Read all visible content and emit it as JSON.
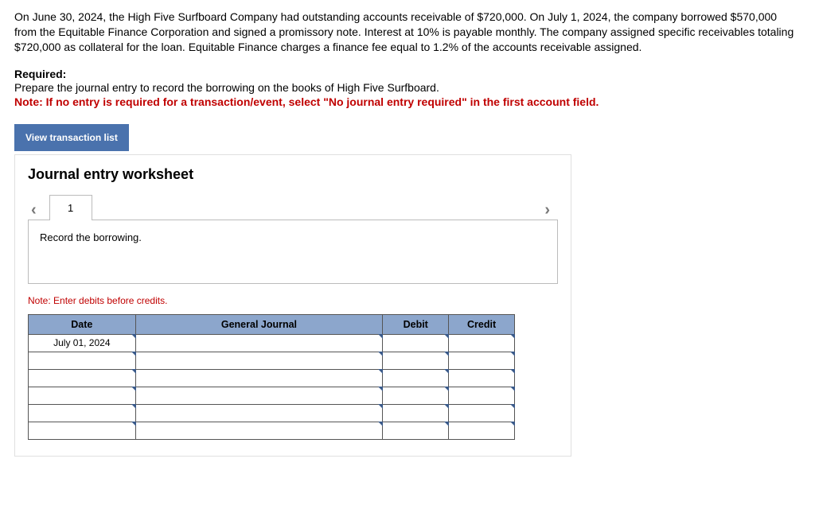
{
  "problem": {
    "text": "On June 30, 2024, the High Five Surfboard Company had outstanding accounts receivable of $720,000. On July 1, 2024, the company borrowed $570,000 from the Equitable Finance Corporation and signed a promissory note. Interest at 10% is payable monthly. The company assigned specific receivables totaling $720,000 as collateral for the loan. Equitable Finance charges a finance fee equal to 1.2% of the accounts receivable assigned."
  },
  "required": {
    "label": "Required:",
    "instruction": "Prepare the journal entry to record the borrowing on the books of High Five Surfboard.",
    "note": "Note: If no entry is required for a transaction/event, select \"No journal entry required\" in the first account field."
  },
  "buttons": {
    "view_transaction_list": "View transaction list"
  },
  "worksheet": {
    "title": "Journal entry worksheet",
    "tabs": [
      "1"
    ],
    "description": "Record the borrowing.",
    "note": "Note: Enter debits before credits.",
    "headers": {
      "date": "Date",
      "general_journal": "General Journal",
      "debit": "Debit",
      "credit": "Credit"
    },
    "rows": [
      {
        "date": "July 01, 2024",
        "gj": "",
        "debit": "",
        "credit": ""
      },
      {
        "date": "",
        "gj": "",
        "debit": "",
        "credit": ""
      },
      {
        "date": "",
        "gj": "",
        "debit": "",
        "credit": ""
      },
      {
        "date": "",
        "gj": "",
        "debit": "",
        "credit": ""
      },
      {
        "date": "",
        "gj": "",
        "debit": "",
        "credit": ""
      },
      {
        "date": "",
        "gj": "",
        "debit": "",
        "credit": ""
      }
    ]
  }
}
